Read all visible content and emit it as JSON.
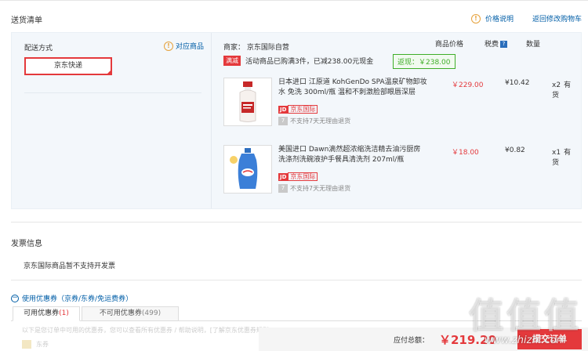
{
  "shipping_list": {
    "title": "送货清单",
    "price_info_link": "价格说明",
    "back_to_cart_link": "返回修改购物车",
    "delivery_method_label": "配送方式",
    "matching_items_link": "对应商品",
    "delivery_option": "京东快递"
  },
  "order": {
    "seller": "商家：  京东国际自营",
    "columns": {
      "price": "商品价格",
      "tax": "税费",
      "qty": "数量"
    },
    "promo_tag": "满减",
    "promo_text": "活动商品已购满3件，已减238.00元现金",
    "rebate": "返现：￥238.00",
    "items": [
      {
        "name": "日本进口 江原道 KohGenDo SPA温泉矿物卸妆水 免洗 300ml/瓶 温和不刺激脸部眼唇深层",
        "jd_badge": "JD",
        "intl_badge": "京东国际",
        "return_policy": "不支持7天无理由退货",
        "price": "￥229.00",
        "tax": "¥10.42",
        "qty": "x2",
        "stock": "有货"
      },
      {
        "name": "美国进口 Dawn滴然超浓缩洗洁精去油污厨房洗涤剂洗碗液护手餐具清洗剂 207ml/瓶",
        "jd_badge": "JD",
        "intl_badge": "京东国际",
        "return_policy": "不支持7天无理由退货",
        "price": "￥18.00",
        "tax": "¥0.82",
        "qty": "x1",
        "stock": "有货"
      }
    ]
  },
  "invoice": {
    "title": "发票信息",
    "note": "京东国际商品暂不支持开发票"
  },
  "coupons": {
    "toggle_label": "使用优惠券（京券/东券/免运费券）",
    "tab_available": "可用优惠券",
    "tab_available_count": "(1)",
    "tab_unavailable": "不可用优惠券",
    "tab_unavailable_count": "(499)",
    "hint": "以下是您订单中可用的优惠券，您可以查看所有优惠券 / 帮助说明，[了解京东优惠券规则]",
    "coupon_type": "东券"
  },
  "footer": {
    "total_label": "应付总额：",
    "total_value": "￥219.20",
    "submit_label": "提交订单"
  },
  "watermark": {
    "main": "值值值",
    "sub": "www.zhizhi.com"
  }
}
